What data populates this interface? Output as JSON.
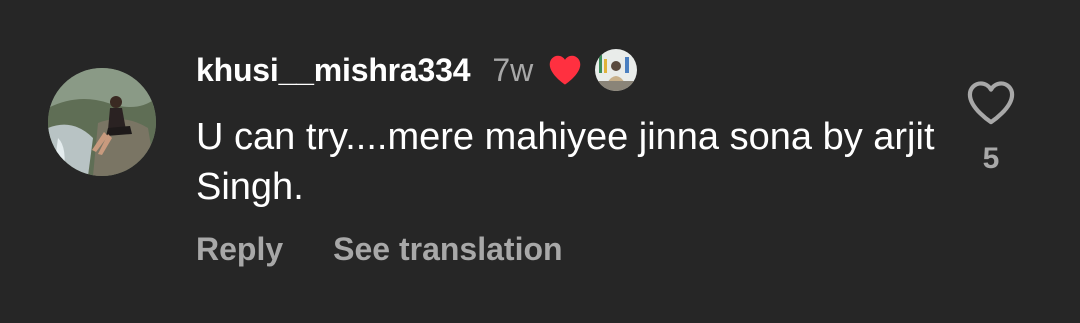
{
  "comment": {
    "username": "khusi__mishra334",
    "time": "7w",
    "text": "U can try....mere mahiyee jinna sona by arjit Singh.",
    "like_count": "5",
    "actions": {
      "reply": "Reply",
      "see_translation": "See translation"
    }
  },
  "icons": {
    "liked_by_creator": "heart-filled-icon",
    "like": "heart-outline-icon"
  },
  "colors": {
    "background": "#262626",
    "primary_text": "#ffffff",
    "secondary_text": "#a8a8a8",
    "heart_red": "#ff3040"
  }
}
